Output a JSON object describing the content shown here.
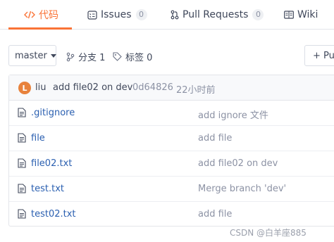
{
  "tabs": {
    "code": "代码",
    "issues": "Issues",
    "issues_count": "0",
    "pull_requests": "Pull Requests",
    "pull_requests_count": "0",
    "wiki": "Wiki"
  },
  "toolbar": {
    "branch": "master",
    "branches": "分支 1",
    "tags": "标签 0",
    "pull_request_button": "+ Pul"
  },
  "last_commit": {
    "avatar_initial": "L",
    "author": "liu",
    "message": "add file02 on dev",
    "sha": "0d64826",
    "time": "22小时前"
  },
  "files": [
    {
      "name": ".gitignore",
      "commit": "add ignore 文件"
    },
    {
      "name": "file",
      "commit": "add file"
    },
    {
      "name": "file02.txt",
      "commit": "add file02 on dev"
    },
    {
      "name": "test.txt",
      "commit": "Merge branch 'dev'"
    },
    {
      "name": "test02.txt",
      "commit": "add file"
    }
  ],
  "watermark": "CSDN @白羊座885",
  "colors": {
    "accent": "#fa7336",
    "link": "#2a5fb0",
    "muted": "#8c92a4"
  }
}
